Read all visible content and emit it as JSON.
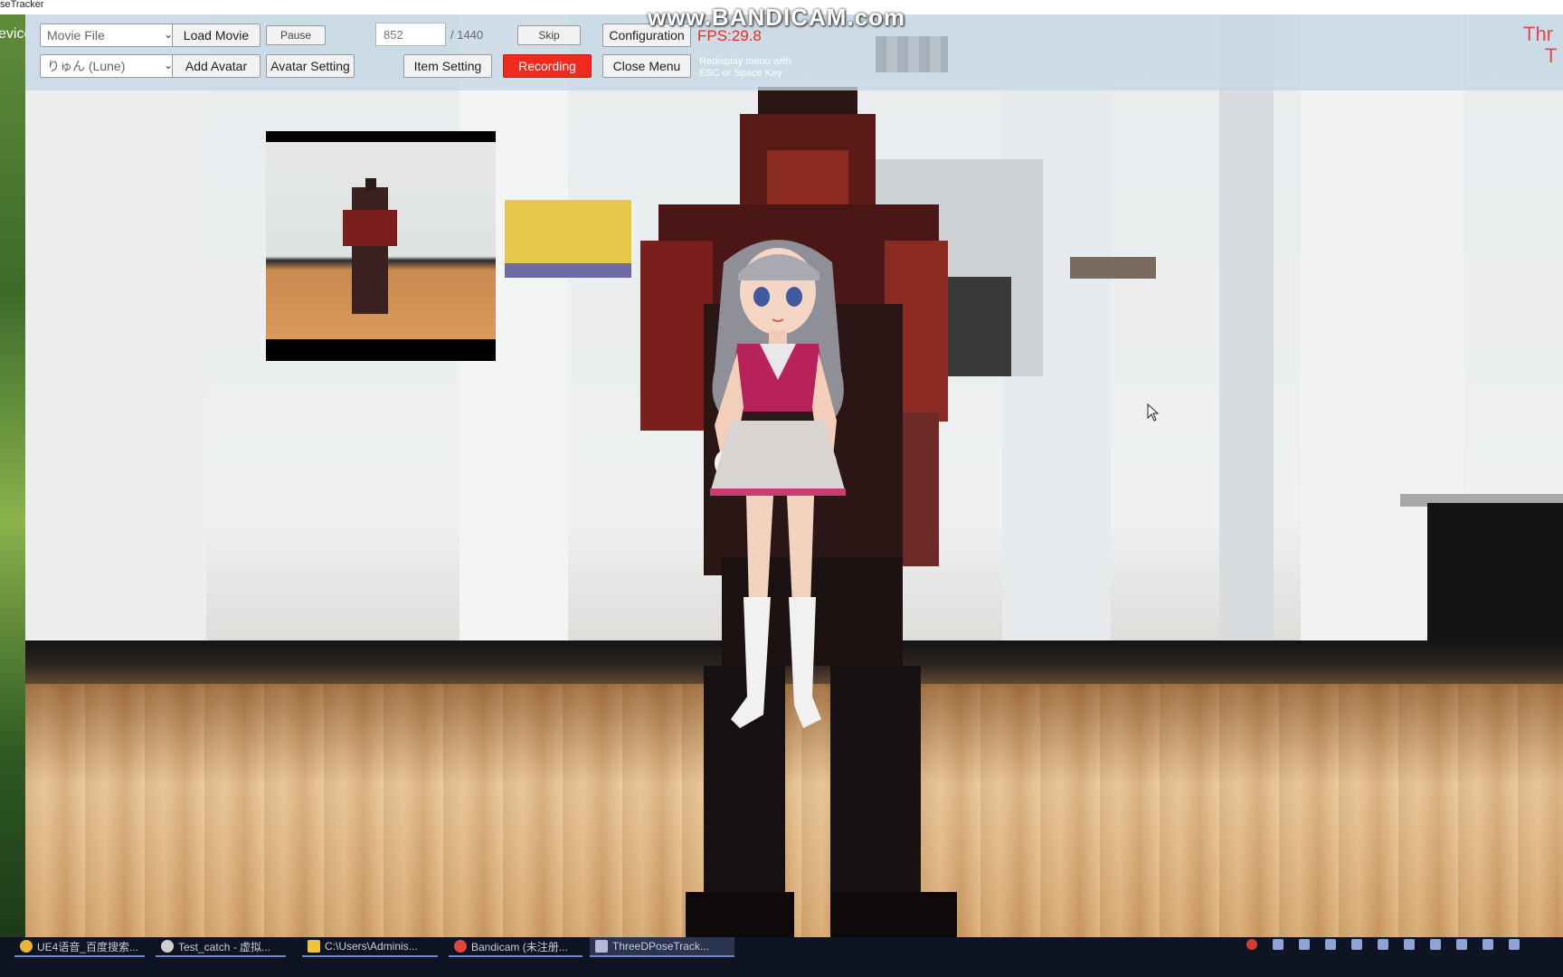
{
  "window": {
    "title": "seTracker"
  },
  "left_panel": {
    "device_label": "evice"
  },
  "watermark": "www.BANDICAM.com",
  "toolbar": {
    "source_select": {
      "value": "Movie File"
    },
    "load_movie": "Load Movie",
    "pause": "Pause",
    "frame_value": "852",
    "frame_total": "/ 1440",
    "skip": "Skip",
    "configuration": "Configuration",
    "fps": "FPS:29.8",
    "avatar_select": {
      "value": "りゅん (Lune)"
    },
    "add_avatar": "Add Avatar",
    "avatar_setting": "Avatar Setting",
    "item_setting": "Item Setting",
    "recording": "Recording",
    "close_menu": "Close Menu",
    "hint_line1": "Redisplay menu with",
    "hint_line2": "ESC or Space Key",
    "right_label_1": "Thr",
    "right_label_2": "T"
  },
  "taskbar": {
    "items": [
      {
        "label": "UE4语音_百度搜索...",
        "color": "#e8b33a"
      },
      {
        "label": "Test_catch - 虚拟...",
        "color": "#cfcfcf"
      },
      {
        "label": "C:\\Users\\Adminis...",
        "color": "#f0c43a"
      },
      {
        "label": "Bandicam (未注册...",
        "color": "#e0473a"
      },
      {
        "label": "ThreeDPoseTrack...",
        "color": "#b8b8d8"
      }
    ]
  },
  "colors": {
    "accent_red": "#ef2a1f",
    "fps_red": "#ee2a1a",
    "toolbar_bg": "#c4d7e6"
  }
}
